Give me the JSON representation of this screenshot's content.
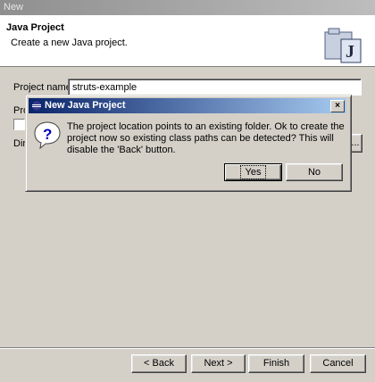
{
  "window": {
    "title": "New"
  },
  "header": {
    "title": "Java Project",
    "description": "Create a new Java project.",
    "icon": "java-project-wizard-icon"
  },
  "form": {
    "project_name_label": "Project name:",
    "project_name_value": "struts-example",
    "project_contents_label_partial": "Pro",
    "directory_label_partial": "Dire",
    "browse_partial": "..."
  },
  "dialog": {
    "title": "New Java Project",
    "message": "The project location points to an existing folder. Ok to create the project now so existing class paths can be detected? This will disable the 'Back' button.",
    "yes_label": "Yes",
    "no_label": "No",
    "close_glyph": "×"
  },
  "footer": {
    "back_label": "< Back",
    "next_label": "Next >",
    "finish_label": "Finish",
    "cancel_label": "Cancel"
  }
}
